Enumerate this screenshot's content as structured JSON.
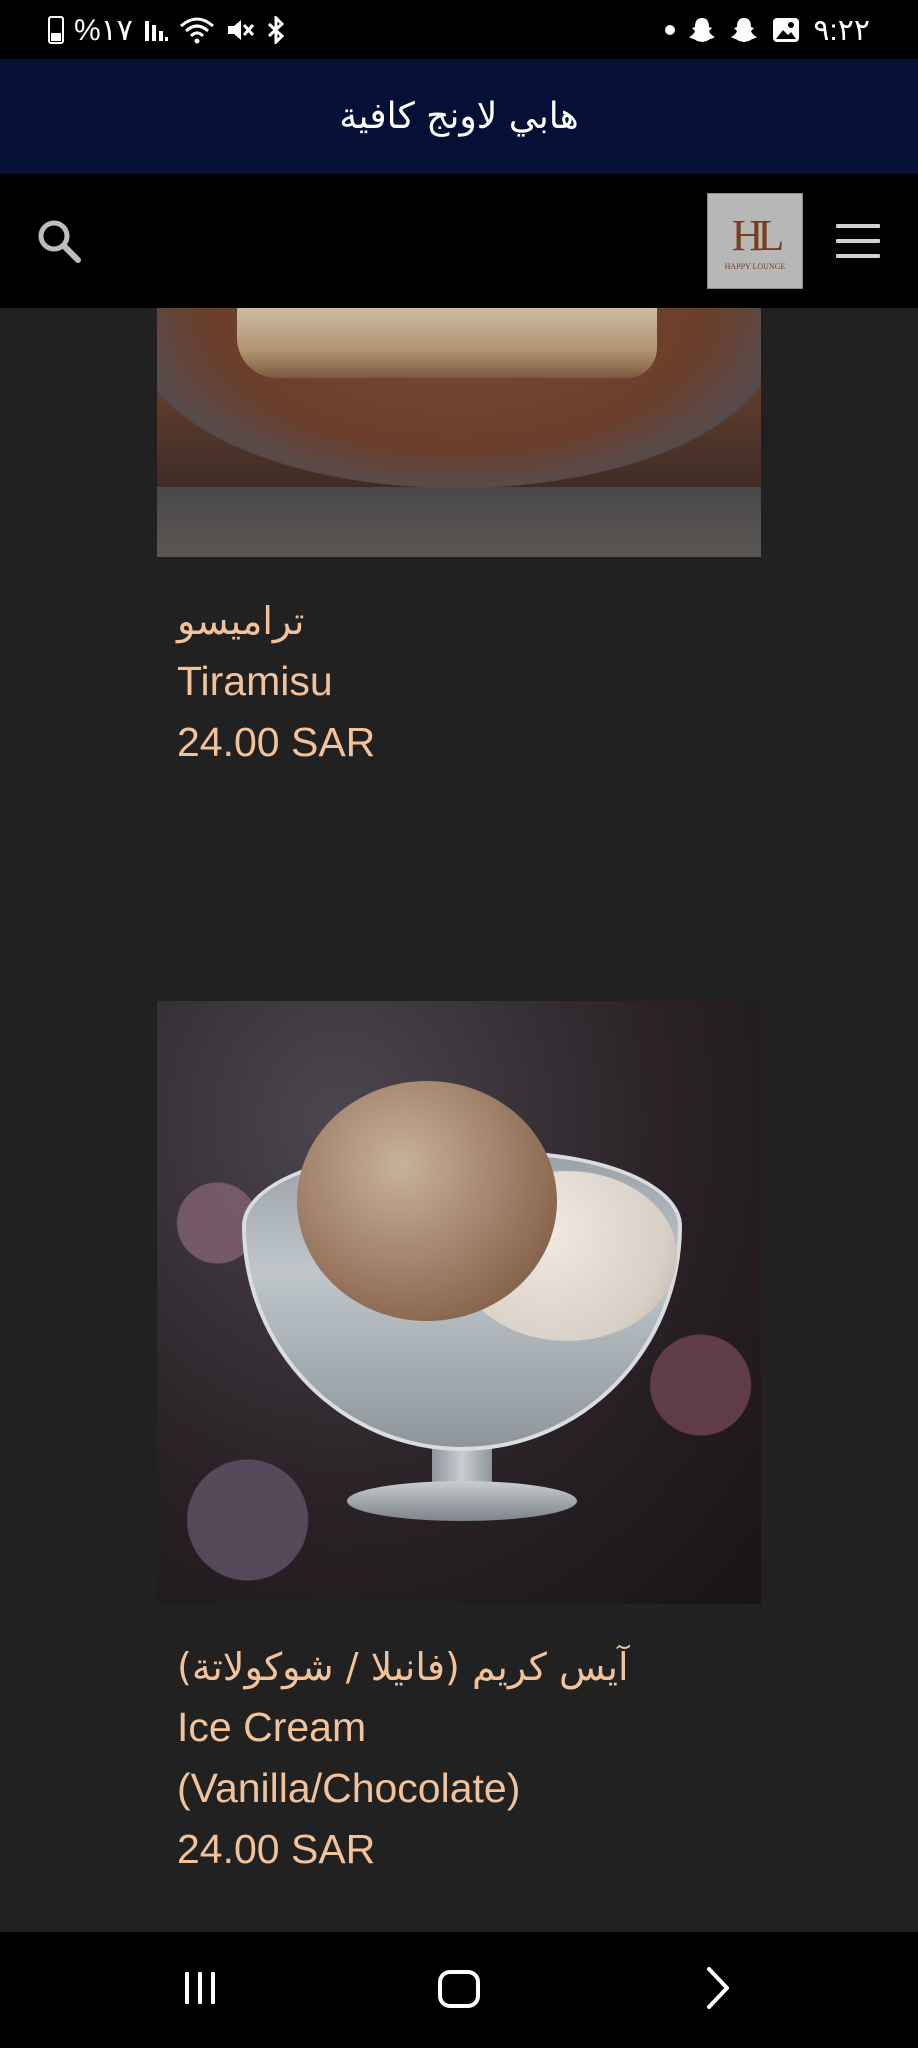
{
  "status_bar": {
    "battery_text": "%١٧",
    "time": "٩:٢٢",
    "icons_left": [
      "battery-icon",
      "signal-icon",
      "wifi-icon",
      "mute-icon",
      "bluetooth-icon"
    ],
    "icons_right": [
      "notification-dot-icon",
      "snapchat-icon",
      "snapchat-icon",
      "gallery-icon"
    ]
  },
  "header": {
    "title": "هابي لاونج كافية",
    "logo_mark": "HL",
    "logo_text": "HAPPY LOUNGE"
  },
  "colors": {
    "banner": "#041036",
    "background": "#212121",
    "text_accent": "#f2c29a"
  },
  "items": [
    {
      "name_ar": "تراميسو",
      "name_en": "Tiramisu",
      "price": "24.00 SAR"
    },
    {
      "name_ar": "آيس كريم (فانيلا / شوكولاتة)",
      "name_en": "Ice Cream (Vanilla/Chocolate)",
      "price": "24.00 SAR"
    }
  ],
  "nav": {
    "icons": [
      "recents-icon",
      "home-icon",
      "back-icon"
    ]
  }
}
